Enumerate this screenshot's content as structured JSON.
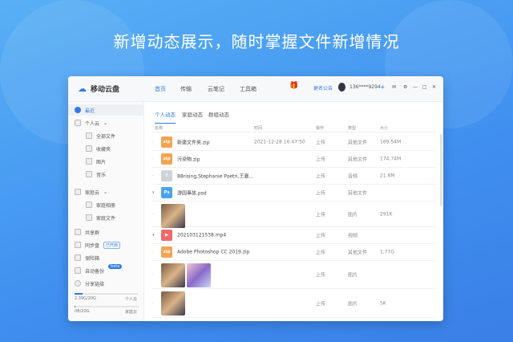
{
  "headline": "新增动态展示，随时掌握文件新增情况",
  "app": {
    "name": "移动云盘",
    "nav": [
      "首页",
      "传输",
      "云笔记",
      "工具箱"
    ],
    "notice": "更名公告",
    "user": "136****9294"
  },
  "sidebar": {
    "recent": "最近",
    "personal": "个人云",
    "personal_items": [
      "全部文件",
      "收藏夹",
      "图片",
      "音乐"
    ],
    "family": "家庭云",
    "family_items": [
      "家庭相册",
      "家庭文件"
    ],
    "share_group": "共享群",
    "sync": "同步盘",
    "sync_badge": "已开启",
    "safe": "保险箱",
    "backup": "自动备份",
    "beta": "beta",
    "share_link": "分享链接",
    "quota": [
      {
        "value": "2.39G/20G",
        "label": "个人云",
        "fraction": 0.12
      },
      {
        "value": "0B/20G",
        "label": "家庭云",
        "fraction": 0.0
      }
    ]
  },
  "tabs": [
    "个人动态",
    "家庭动态",
    "群组动态"
  ],
  "columns": [
    "名称",
    "时间",
    "操作",
    "类型",
    "大小"
  ],
  "rows": [
    {
      "icon": "zip",
      "name": "新建文件夹.zip",
      "time": "2021-12-28 16:47:50",
      "op": "上传",
      "type": "其他文件",
      "size": "169.54M"
    },
    {
      "icon": "zip",
      "name": "污染物.zip",
      "time": "",
      "op": "上传",
      "type": "其他文件",
      "size": "174.74M"
    },
    {
      "icon": "?",
      "name": "88rising,Stephanie Poetri,王嘉...",
      "time": "",
      "op": "上传",
      "type": "音频",
      "size": "21.8M"
    },
    {
      "icon": "Ps",
      "name": "游园事故.psd",
      "time": "",
      "op": "上传",
      "type": "其他文件",
      "size": ""
    },
    {
      "icon": "img",
      "name": "",
      "time": "",
      "op": "上传",
      "type": "图片",
      "size": "291K"
    },
    {
      "icon": "video",
      "name": "202103121538.mp4",
      "time": "",
      "op": "上传",
      "type": "视频",
      "size": ""
    },
    {
      "icon": "zip",
      "name": "Adobe Photoshop CC 2019.zip",
      "time": "",
      "op": "上传",
      "type": "其他文件",
      "size": "1.77G"
    },
    {
      "icon": "img2",
      "name": "",
      "time": "",
      "op": "上传",
      "type": "图片",
      "size": ""
    },
    {
      "icon": "img",
      "name": "",
      "time": "",
      "op": "上传",
      "type": "图片",
      "size": "5K"
    }
  ],
  "colors": {
    "accent": "#2e7be6",
    "zip": "#f5a351",
    "ps": "#4aa3f0",
    "video": "#ee6a6a",
    "unknown": "#cfd3d8"
  }
}
